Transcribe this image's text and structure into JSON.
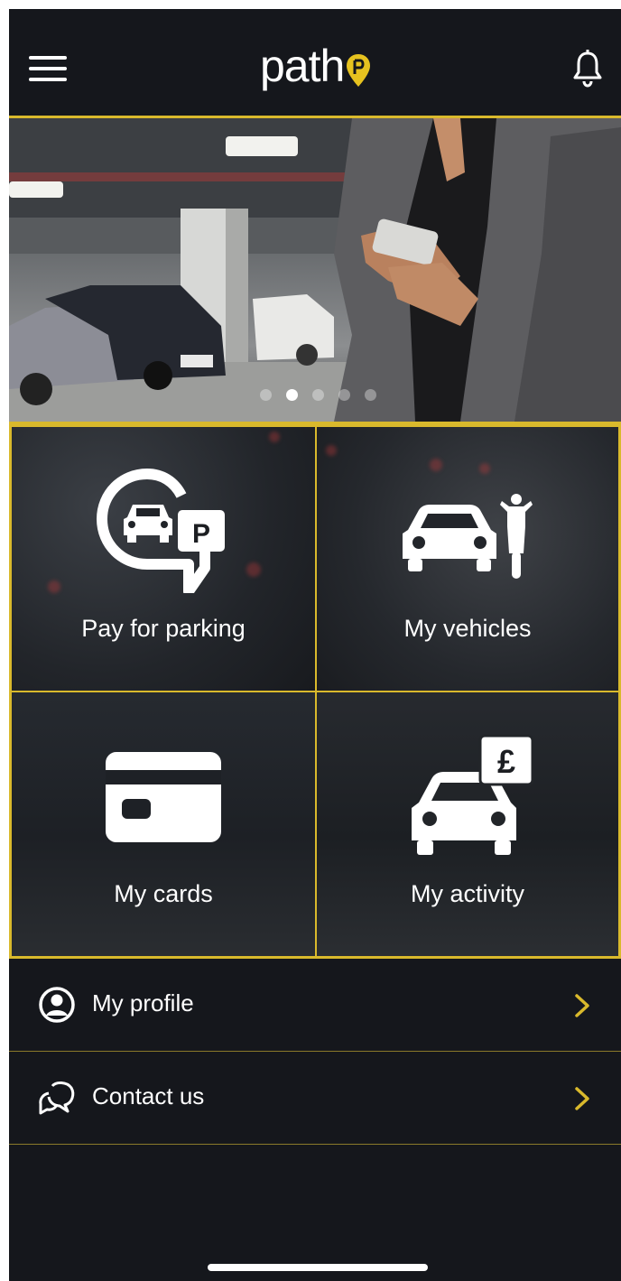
{
  "app": {
    "brand": "path",
    "accent_color": "#d9b92c",
    "background": "#15171c"
  },
  "header": {
    "menu_icon": "hamburger-icon",
    "notification_icon": "bell-icon"
  },
  "carousel": {
    "slide_count": 5,
    "active_slide": 1
  },
  "tiles": [
    {
      "label": "Pay for parking",
      "icon": "parking-payment-icon"
    },
    {
      "label": "My vehicles",
      "icon": "car-motorbike-icon"
    },
    {
      "label": "My cards",
      "icon": "credit-card-icon"
    },
    {
      "label": "My activity",
      "icon": "car-pound-icon"
    }
  ],
  "menu": [
    {
      "label": "My profile",
      "icon": "user-circle-icon"
    },
    {
      "label": "Contact us",
      "icon": "chat-bubbles-icon"
    }
  ]
}
